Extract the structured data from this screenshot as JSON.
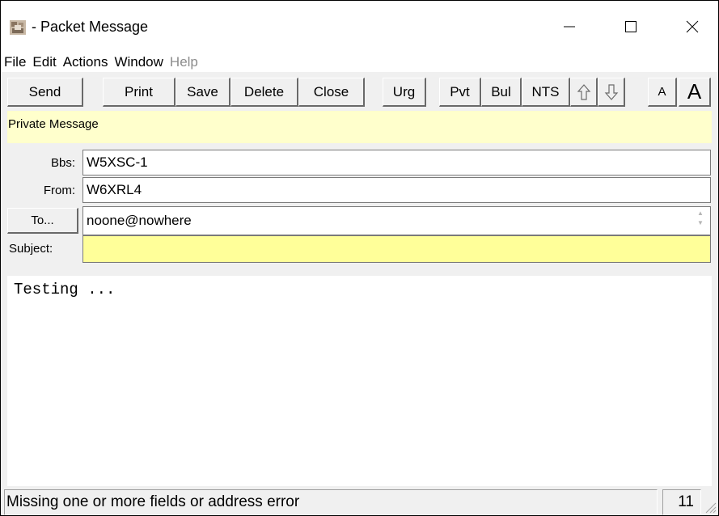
{
  "window": {
    "title": "- Packet Message",
    "minimize_icon": "minimize-icon",
    "maximize_icon": "maximize-icon",
    "close_icon": "close-icon"
  },
  "menubar": {
    "items": [
      {
        "label": "File",
        "enabled": true
      },
      {
        "label": "Edit",
        "enabled": true
      },
      {
        "label": "Actions",
        "enabled": true
      },
      {
        "label": "Window",
        "enabled": true
      },
      {
        "label": "Help",
        "enabled": false
      }
    ]
  },
  "toolbar": {
    "send": "Send",
    "print": "Print",
    "save": "Save",
    "delete": "Delete",
    "close": "Close",
    "urg": "Urg",
    "pvt": "Pvt",
    "bul": "Bul",
    "nts": "NTS",
    "up_icon": "arrow-up-icon",
    "down_icon": "arrow-down-icon",
    "font_small": "A",
    "font_large": "A"
  },
  "banner": {
    "text": "Private Message",
    "color": "#ffffcc"
  },
  "fields": {
    "bbs_label": "Bbs:",
    "bbs_value": "W5XSC-1",
    "from_label": "From:",
    "from_value": "W6XRL4",
    "to_button": "To...",
    "to_value": "noone@nowhere",
    "subject_label": "Subject:",
    "subject_value": "",
    "subject_highlight": "#ffff99"
  },
  "body": {
    "text": "Testing ..."
  },
  "statusbar": {
    "message": "Missing one or more fields or address error",
    "count": "11"
  }
}
